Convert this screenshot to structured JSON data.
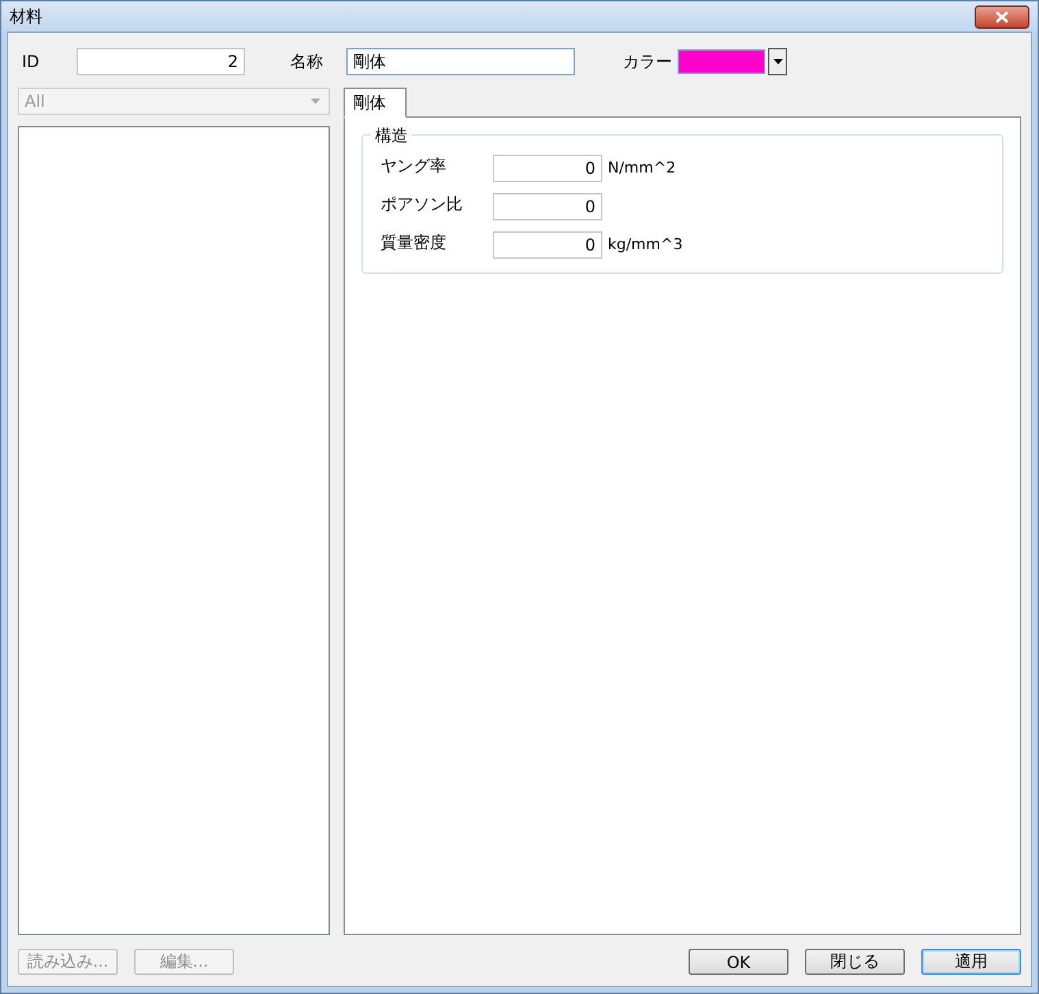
{
  "window": {
    "title": "材料"
  },
  "id_field": {
    "label": "ID",
    "value": "2"
  },
  "name_field": {
    "label": "名称",
    "value": "剛体"
  },
  "color_field": {
    "label": "カラー",
    "color": "#ff00cc"
  },
  "filter": {
    "value": "All",
    "disabled": true
  },
  "tabs": [
    {
      "label": "剛体",
      "selected": true
    }
  ],
  "group": {
    "title": "構造",
    "rows": [
      {
        "label": "ヤング率",
        "value": "0",
        "unit": "N/mm^2"
      },
      {
        "label": "ポアソン比",
        "value": "0"
      },
      {
        "label": "質量密度",
        "value": "0",
        "unit": "kg/mm^3"
      }
    ]
  },
  "left_buttons": [
    {
      "label": "読み込み...",
      "disabled": true
    },
    {
      "label": "編集...",
      "disabled": true
    }
  ],
  "buttons": [
    {
      "label": "OK",
      "default": false
    },
    {
      "label": "閉じる",
      "default": false
    },
    {
      "label": "適用",
      "default": true
    }
  ]
}
